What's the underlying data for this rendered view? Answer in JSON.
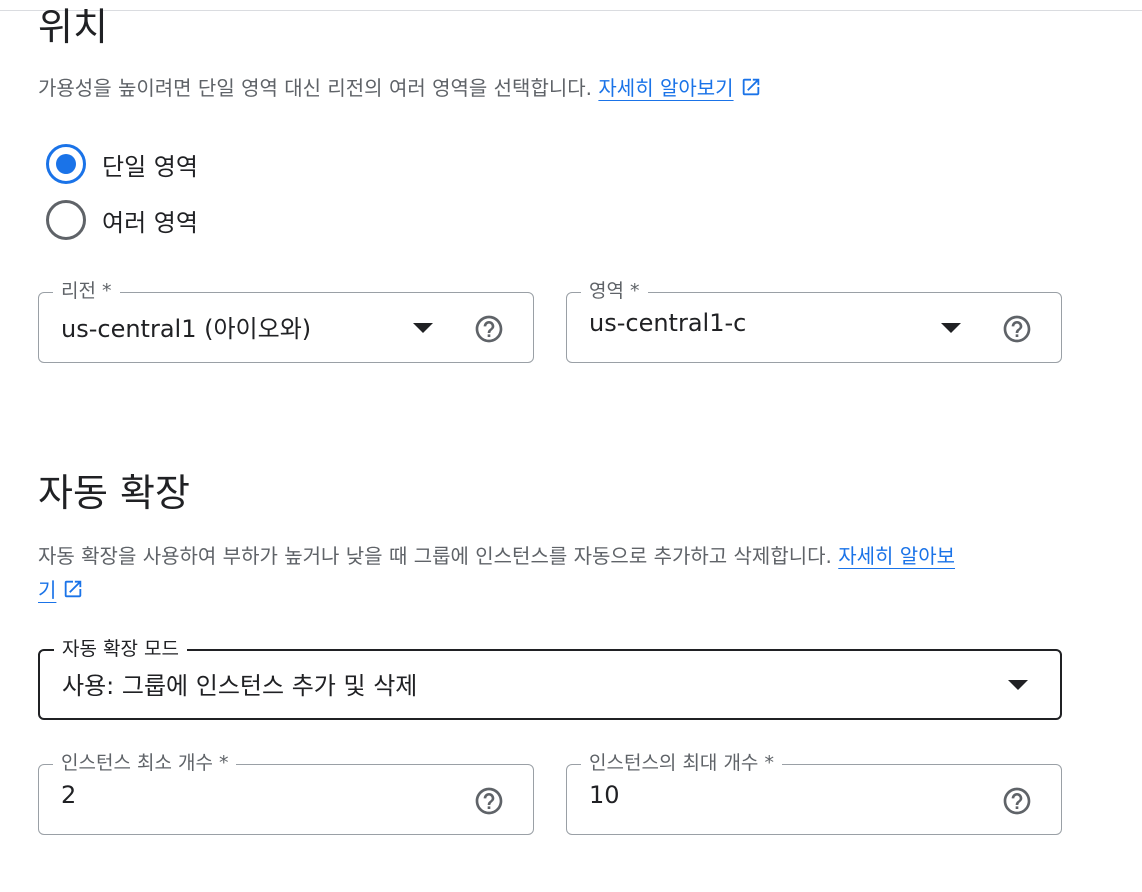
{
  "location": {
    "title": "위치",
    "description": "가용성을 높이려면 단일 영역 대신 리전의 여러 영역을 선택합니다.",
    "learn_more": "자세히 알아보기",
    "options": [
      {
        "label": "단일 영역",
        "selected": true
      },
      {
        "label": "여러 영역",
        "selected": false
      }
    ],
    "region": {
      "label": "리전 *",
      "value": "us-central1 (아이오와)"
    },
    "zone": {
      "label": "영역 *",
      "value": "us-central1-c"
    }
  },
  "autoscaling": {
    "title": "자동 확장",
    "description": "자동 확장을 사용하여 부하가 높거나 낮을 때 그룹에 인스턴스를 자동으로 추가하고 삭제합니다.",
    "learn_more_part1": "자세히 알아보",
    "learn_more_part2": "기",
    "mode": {
      "label": "자동 확장 모드",
      "value": "사용: 그룹에 인스턴스 추가 및 삭제"
    },
    "min_instances": {
      "label": "인스턴스 최소 개수 *",
      "value": "2"
    },
    "max_instances": {
      "label": "인스턴스의 최대 개수 *",
      "value": "10"
    }
  },
  "icons": {
    "external_link": "external-link-icon",
    "help": "help-circle-icon",
    "dropdown": "caret-down-icon"
  },
  "colors": {
    "accent": "#1a73e8",
    "text_primary": "#202124",
    "text_secondary": "#5f6368",
    "border": "#9aa0a6"
  }
}
